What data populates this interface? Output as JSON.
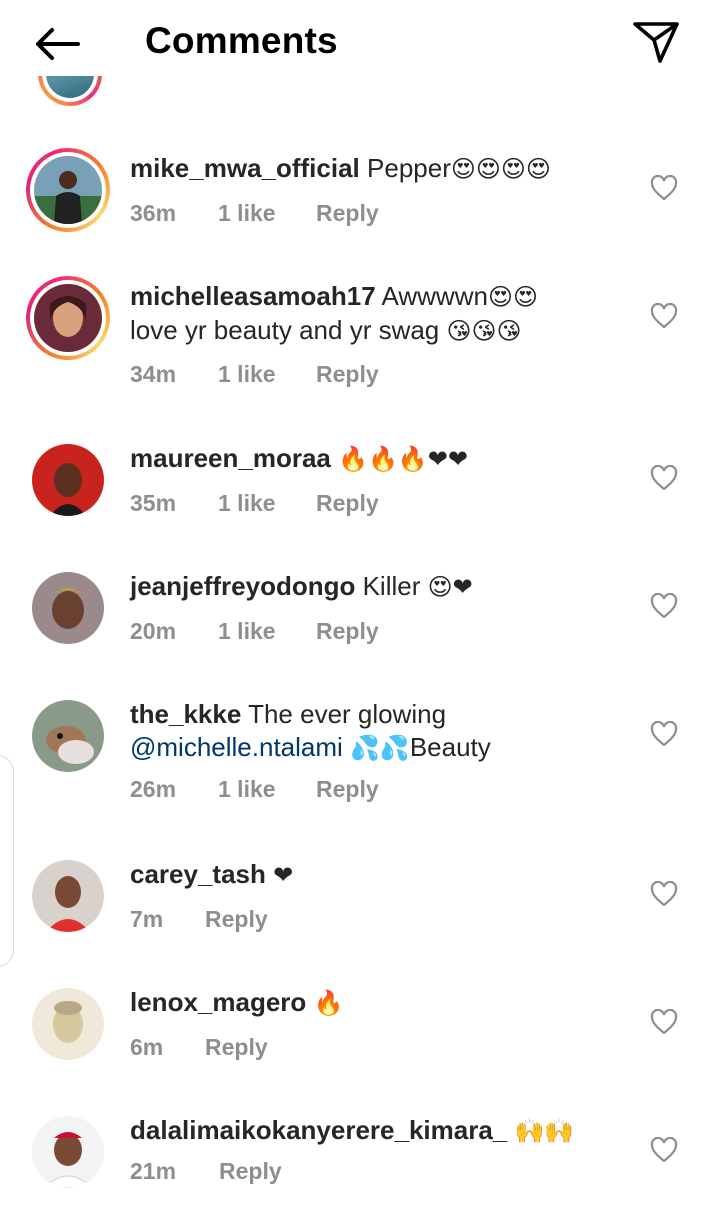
{
  "header": {
    "title": "Comments",
    "back_icon": "arrow-left-icon",
    "share_icon": "send-icon"
  },
  "comments": [
    {
      "username": "mike_mwa_official",
      "text": "Pepper",
      "emoji": "😍😍😍😍",
      "time": "36m",
      "likes": "1 like",
      "reply": "Reply",
      "story_ring": true
    },
    {
      "username": "michelleasamoah17",
      "text": "Awwwwn",
      "emoji": "😍😍",
      "text2": "love yr beauty and yr swag",
      "emoji2": "😘😘😘",
      "time": "34m",
      "likes": "1 like",
      "reply": "Reply",
      "story_ring": true
    },
    {
      "username": "maureen_moraa",
      "text": "",
      "emoji": "🔥🔥🔥❤❤",
      "time": "35m",
      "likes": "1 like",
      "reply": "Reply",
      "story_ring": false
    },
    {
      "username": "jeanjeffreyodongo",
      "text": "Killer",
      "emoji": "😍❤",
      "time": "20m",
      "likes": "1 like",
      "reply": "Reply",
      "story_ring": false
    },
    {
      "username": "the_kkke",
      "text": "The ever glowing",
      "mention": "@michelle.ntalami",
      "emoji": "💦💦",
      "text2": "Beauty",
      "time": "26m",
      "likes": "1 like",
      "reply": "Reply",
      "story_ring": false
    },
    {
      "username": "carey_tash",
      "text": "",
      "emoji": "❤",
      "time": "7m",
      "reply": "Reply",
      "story_ring": false
    },
    {
      "username": "lenox_magero",
      "text": "",
      "emoji": "🔥",
      "time": "6m",
      "reply": "Reply",
      "story_ring": false
    },
    {
      "username": "dalalimaikokanyerere_kimara_",
      "text": "",
      "emoji": "🙌🙌",
      "time": "21m",
      "reply": "Reply",
      "story_ring": false
    }
  ],
  "colors": {
    "ring_start": "#f58529",
    "ring_end": "#dd2a7b",
    "mention": "#00376b",
    "meta": "#8e8e8e",
    "heart_red": "#e0245e"
  }
}
